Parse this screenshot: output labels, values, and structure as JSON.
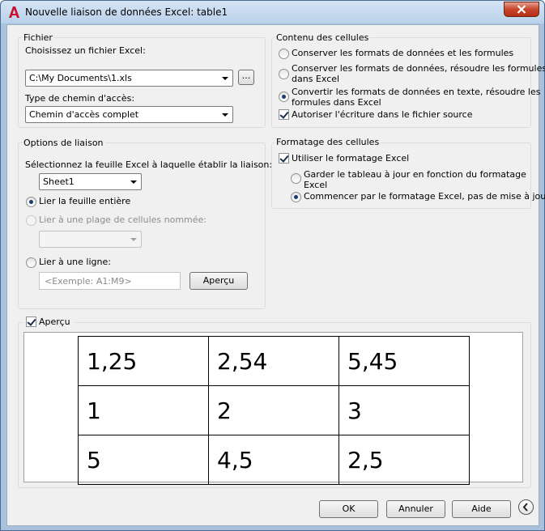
{
  "window": {
    "title": "Nouvelle liaison de données Excel: table1",
    "app_icon": "autocad-a-icon",
    "close_icon": "close-icon"
  },
  "fichier": {
    "legend": "Fichier",
    "choose_label": "Choisissez un fichier Excel:",
    "file_value": "C:\\My Documents\\1.xls",
    "browse_label": "...",
    "path_type_label": "Type de chemin d'accès:",
    "path_type_value": "Chemin d'accès complet"
  },
  "contenu": {
    "legend": "Contenu des cellules",
    "opt1": "Conserver les formats de données et les formules",
    "opt2a": "Conserver les formats de données, résoudre les formules",
    "opt2b": "dans Excel",
    "opt3a": "Convertir les formats de données en texte, résoudre les",
    "opt3b": "formules dans Excel",
    "allow_write": "Autoriser l'écriture dans le fichier source"
  },
  "options": {
    "legend": "Options de liaison",
    "select_label": "Sélectionnez la feuille Excel à laquelle établir la liaison:",
    "sheet_value": "Sheet1",
    "link_sheet": "Lier la feuille entière",
    "link_range": "Lier à une plage de cellules nommée:",
    "link_line": "Lier à une ligne:",
    "range_placeholder": "<Exemple: A1:M9>",
    "preview_button": "Aperçu"
  },
  "formatage": {
    "legend": "Formatage des cellules",
    "use_excel": "Utiliser le formatage Excel",
    "keep_a": "Garder le tableau à jour en fonction du formatage",
    "keep_b": "Excel",
    "start_excel": "Commencer par le formatage Excel, pas de mise à jour"
  },
  "apercu": {
    "label": "Aperçu",
    "rows": [
      [
        "1,25",
        "2,54",
        "5,45"
      ],
      [
        "1",
        "2",
        "3"
      ],
      [
        "5",
        "4,5",
        "2,5"
      ]
    ]
  },
  "footer": {
    "ok": "OK",
    "cancel": "Annuler",
    "help": "Aide",
    "collapse_icon": "chevron-left-icon"
  },
  "colors": {
    "titlebar": "#c5dbf0",
    "close": "#c7452b",
    "dialog_bg": "#f0f0f0"
  }
}
